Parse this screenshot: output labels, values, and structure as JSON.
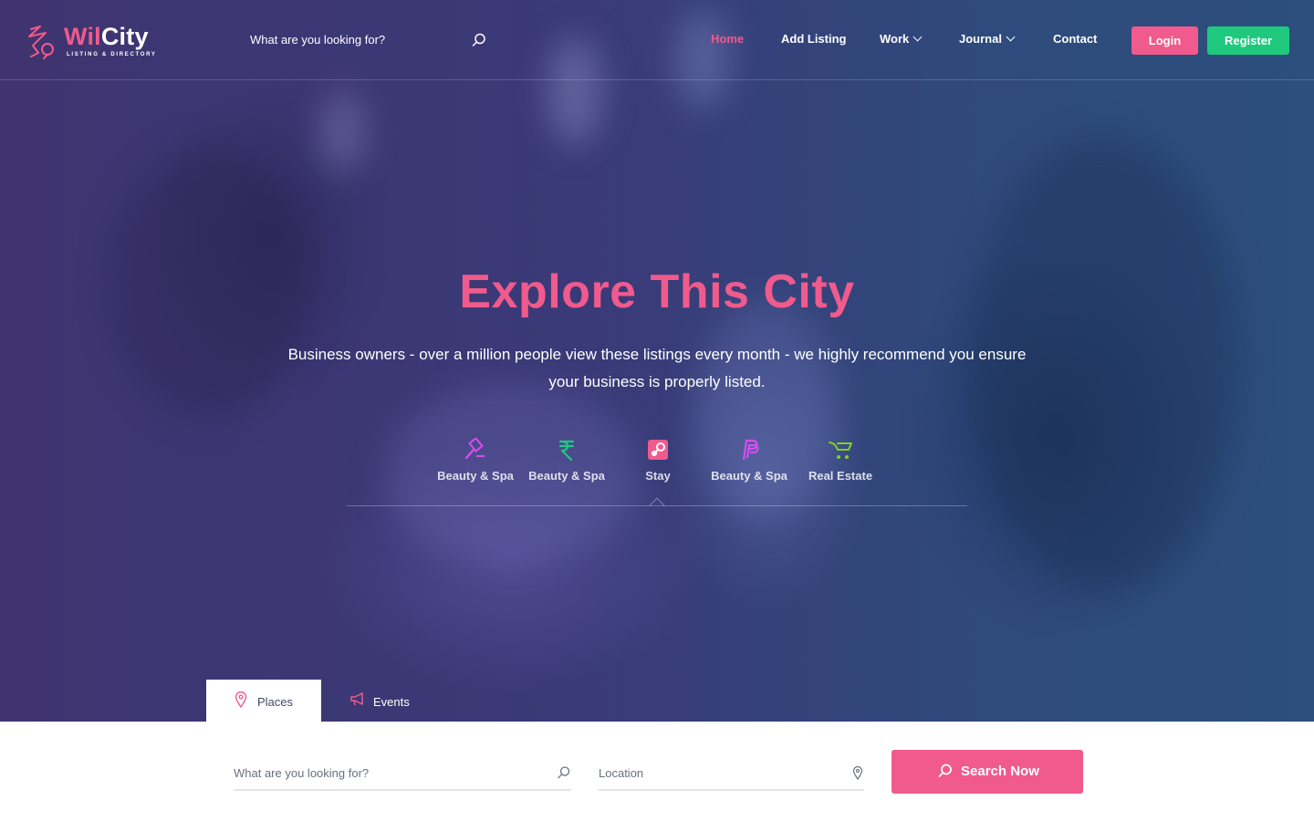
{
  "brand": {
    "name_part1": "Wil",
    "name_part2": "City",
    "tagline": "LISTING & DIRECTORY",
    "accent_color": "#f05a8c",
    "secondary_color": "#1ec97e"
  },
  "header": {
    "search_placeholder": "What are you looking for?",
    "search_icon": "search-icon",
    "nav": [
      {
        "label": "Home",
        "active": true
      },
      {
        "label": "Add Listing",
        "active": false
      },
      {
        "label": "Work",
        "active": false,
        "dropdown": true
      },
      {
        "label": "Journal",
        "active": false,
        "dropdown": true
      },
      {
        "label": "Contact",
        "active": false
      }
    ],
    "login_label": "Login",
    "register_label": "Register"
  },
  "hero": {
    "title": "Explore This City",
    "subtitle": "Business owners - over a million people view these listings every month - we highly recommend you ensure your business is properly listed.",
    "categories": [
      {
        "label": "Beauty & Spa",
        "icon": "gavel-icon",
        "color": "#d64ef0"
      },
      {
        "label": "Beauty & Spa",
        "icon": "rupee-icon",
        "color": "#1ec97e"
      },
      {
        "label": "Stay",
        "icon": "steam-icon",
        "color": "#f05a8c",
        "selected": true
      },
      {
        "label": "Beauty & Spa",
        "icon": "paypal-icon",
        "color": "#d64ef0"
      },
      {
        "label": "Real Estate",
        "icon": "cart-icon",
        "color": "#7ed321"
      }
    ]
  },
  "search": {
    "tabs": [
      {
        "label": "Places",
        "icon": "map-pin-icon",
        "active": true
      },
      {
        "label": "Events",
        "icon": "megaphone-icon",
        "active": false
      }
    ],
    "keyword_placeholder": "What are you looking for?",
    "location_placeholder": "Location",
    "button_label": "Search Now"
  }
}
